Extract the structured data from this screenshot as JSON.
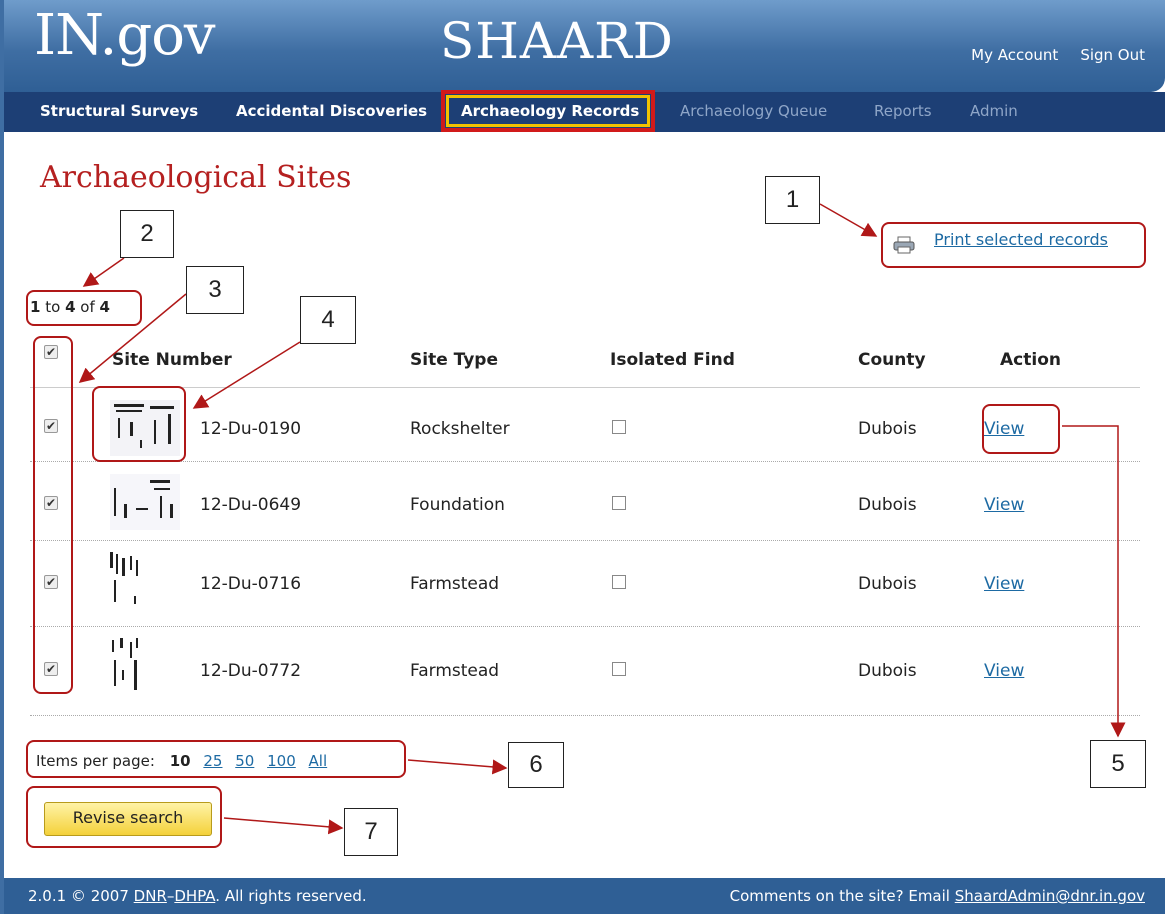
{
  "header": {
    "logo": "IN.gov",
    "app_title": "SHAARD",
    "my_account": "My Account",
    "sign_out": "Sign Out"
  },
  "nav": [
    "Structural Surveys",
    "Accidental Discoveries",
    "Archaeology Records",
    "Archaeology Queue",
    "Reports",
    "Admin"
  ],
  "page_title": "Archaeological Sites",
  "print_label": "Print selected records",
  "count": {
    "from": "1",
    "to_word": "to",
    "to": "4",
    "of_word": "of",
    "total": "4"
  },
  "table": {
    "headers": [
      "Site Number",
      "Site Type",
      "Isolated Find",
      "County",
      "Action"
    ],
    "rows": [
      {
        "site_number": "12-Du-0190",
        "site_type": "Rockshelter",
        "county": "Dubois",
        "action": "View"
      },
      {
        "site_number": "12-Du-0649",
        "site_type": "Foundation",
        "county": "Dubois",
        "action": "View"
      },
      {
        "site_number": "12-Du-0716",
        "site_type": "Farmstead",
        "county": "Dubois",
        "action": "View"
      },
      {
        "site_number": "12-Du-0772",
        "site_type": "Farmstead",
        "county": "Dubois",
        "action": "View"
      }
    ]
  },
  "items_per_page": {
    "label": "Items per page:",
    "current": "10",
    "options": [
      "25",
      "50",
      "100",
      "All"
    ]
  },
  "revise_search": "Revise search",
  "footer": {
    "version": "2.0.1 © 2007",
    "dnr": "DNR",
    "dash": "–",
    "dhpa": "DHPA",
    "rights": ". All rights reserved.",
    "comments": "Comments on the site? Email",
    "email": "ShaardAdmin@dnr.in.gov"
  },
  "callouts": [
    "1",
    "2",
    "3",
    "4",
    "5",
    "6",
    "7"
  ],
  "colors": {
    "header_blue": "#3f6ea3",
    "nav_blue": "#1d3f75",
    "title_red": "#b52020",
    "callout_red": "#b01818",
    "link_blue": "#1d6aa3"
  }
}
